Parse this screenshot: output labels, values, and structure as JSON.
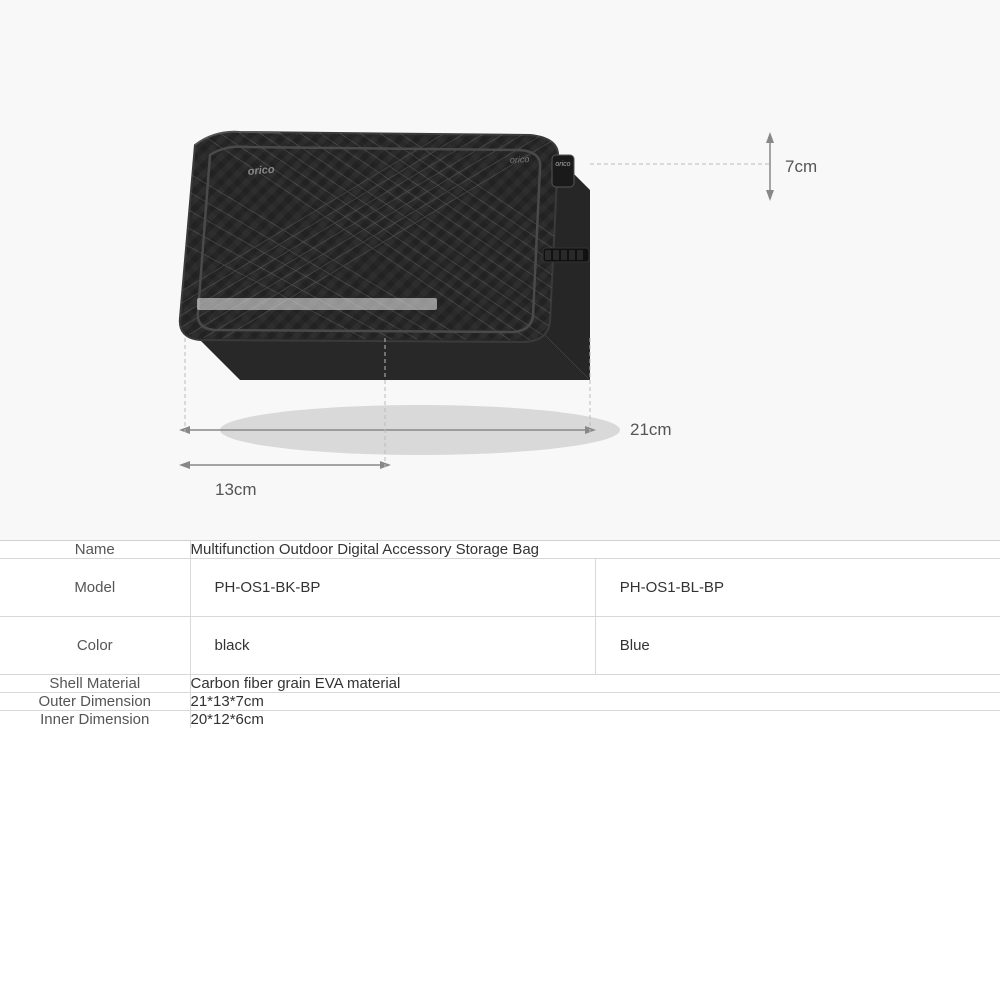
{
  "image_section": {
    "dimensions": {
      "width_label": "21cm",
      "depth_label": "13cm",
      "height_label": "7cm"
    }
  },
  "specs": {
    "rows": [
      {
        "label": "Name",
        "value": "Multifunction Outdoor Digital Accessory Storage Bag",
        "type": "single"
      },
      {
        "label": "Model",
        "value1": "PH-OS1-BK-BP",
        "value2": "PH-OS1-BL-BP",
        "type": "double"
      },
      {
        "label": "Color",
        "value1": "black",
        "value2": "Blue",
        "type": "double"
      },
      {
        "label": "Shell Material",
        "value": "Carbon fiber grain EVA material",
        "type": "single"
      },
      {
        "label": "Outer Dimension",
        "value": "21*13*7cm",
        "type": "single"
      },
      {
        "label": "Inner Dimension",
        "value": "20*12*6cm",
        "type": "single"
      }
    ]
  }
}
